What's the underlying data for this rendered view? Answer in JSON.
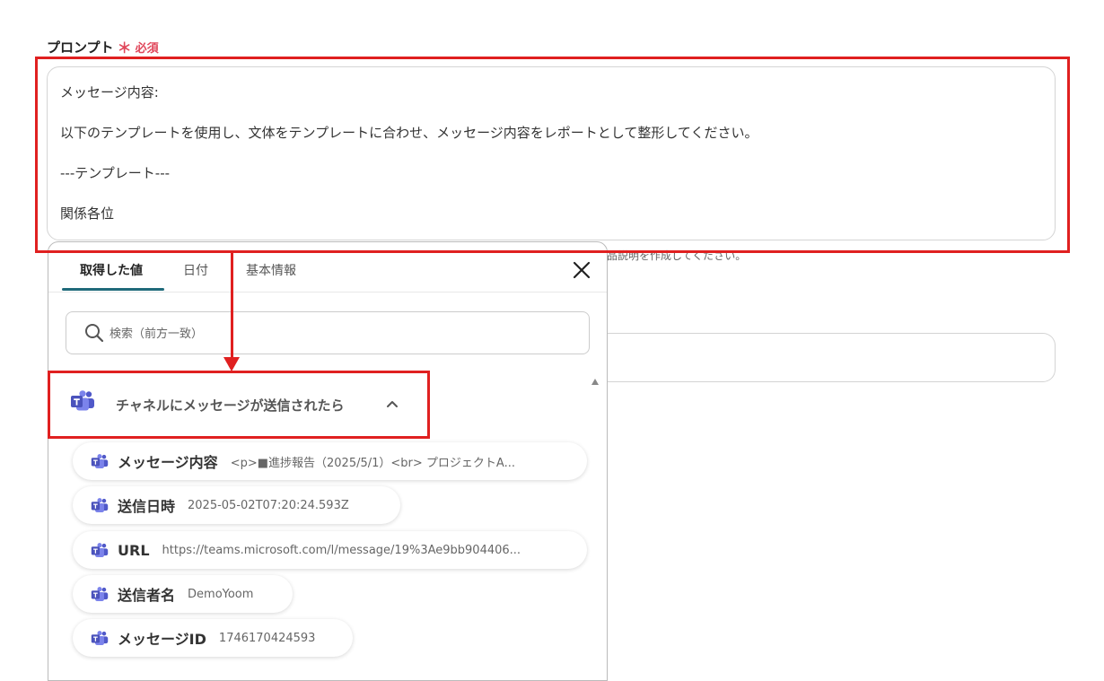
{
  "field": {
    "label": "プロンプト",
    "required_mark": "＊",
    "required_text": "必須"
  },
  "prompt_lines": [
    "メッセージ内容:",
    "以下のテンプレートを使用し、文体をテンプレートに合わせ、メッセージ内容をレポートとして整形してください。",
    "---テンプレート---",
    "関係各位"
  ],
  "hint_text": "商品説明を作成してください。",
  "popup": {
    "tabs": [
      {
        "label": "取得した値",
        "active": true
      },
      {
        "label": "日付",
        "active": false
      },
      {
        "label": "基本情報",
        "active": false
      }
    ],
    "close_icon": "close-icon",
    "search": {
      "placeholder": "検索（前方一致）",
      "value": ""
    },
    "group": {
      "icon": "teams-icon",
      "label": "チャネルにメッセージが送信されたら",
      "expanded": true
    },
    "items": [
      {
        "name": "メッセージ内容",
        "value": "<p>■進捗報告（2025/5/1）<br> プロジェクトA..."
      },
      {
        "name": "送信日時",
        "value": "2025-05-02T07:20:24.593Z"
      },
      {
        "name": "URL",
        "value": "https://teams.microsoft.com/l/message/19%3Ae9bb904406..."
      },
      {
        "name": "送信者名",
        "value": "DemoYoom"
      },
      {
        "name": "メッセージID",
        "value": "1746170424593"
      }
    ]
  },
  "colors": {
    "annotation": "#e02020",
    "required": "#e0465a",
    "tab_underline": "#1f6a7a",
    "teams": "#5059c9"
  }
}
